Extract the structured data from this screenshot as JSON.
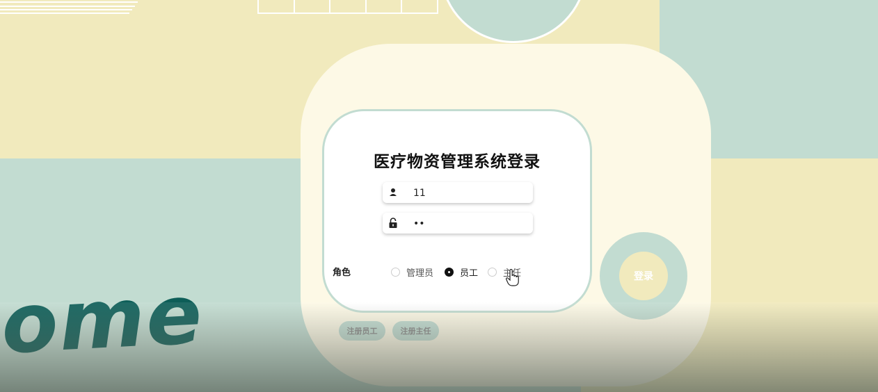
{
  "page": {
    "title": "医疗物资管理系统登录",
    "welcome_text": "come"
  },
  "form": {
    "username_value": "11",
    "password_value": "11",
    "role_label": "角色",
    "roles": [
      "管理员",
      "员工",
      "主任"
    ],
    "selected_role": "员工",
    "login_label": "登录",
    "register_employee_label": "注册员工",
    "register_director_label": "注册主任"
  },
  "colors": {
    "sage_green": "#c2dcd1",
    "cream_yellow": "#f1eabd",
    "card_bg": "#fdf9e6",
    "welcome_text": "#0d5e58"
  },
  "icons": {
    "username": "user-icon",
    "password": "lock-icon",
    "cursor": "hand-pointer-icon"
  }
}
